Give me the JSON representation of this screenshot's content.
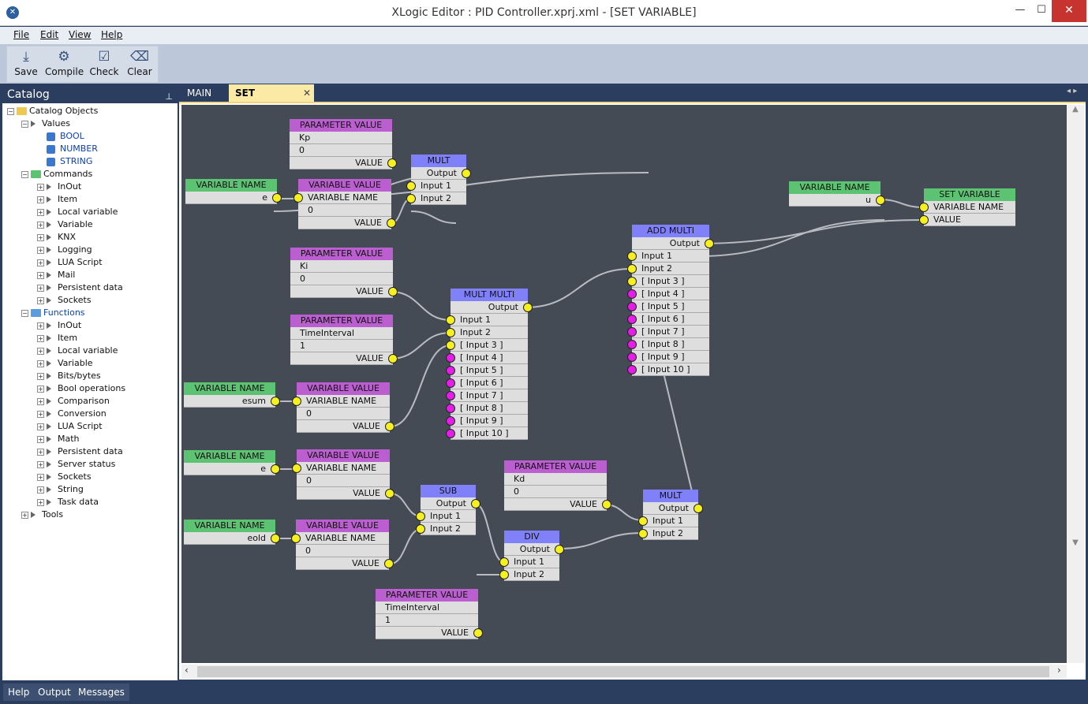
{
  "window": {
    "title": "XLogic Editor : PID Controller.xprj.xml - [SET VARIABLE]"
  },
  "menu": {
    "file": "File",
    "edit": "Edit",
    "view": "View",
    "help": "Help"
  },
  "toolbar": {
    "save": "Save",
    "compile": "Compile",
    "check": "Check",
    "clear": "Clear"
  },
  "catalog": {
    "title": "Catalog",
    "root": "Catalog Objects",
    "values": {
      "label": "Values",
      "items": [
        "BOOL",
        "NUMBER",
        "STRING"
      ]
    },
    "commands": {
      "label": "Commands",
      "items": [
        "InOut",
        "Item",
        "Local variable",
        "Variable",
        "KNX",
        "Logging",
        "LUA Script",
        "Mail",
        "Persistent data",
        "Sockets"
      ]
    },
    "functions": {
      "label": "Functions",
      "items": [
        "InOut",
        "Item",
        "Local variable",
        "Variable",
        "Bits/bytes",
        "Bool operations",
        "Comparison",
        "Conversion",
        "LUA Script",
        "Math",
        "Persistent data",
        "Server status",
        "Sockets",
        "String",
        "Task data"
      ]
    },
    "tools": "Tools"
  },
  "tabs": {
    "main": "MAIN",
    "active": "SET VARIABLE",
    "close": "✕"
  },
  "nodes": {
    "pv_kp": {
      "title": "PARAMETER VALUE",
      "name": "Kp",
      "value": "0",
      "out": "VALUE"
    },
    "vn_e1": {
      "title": "VARIABLE NAME",
      "name": "e"
    },
    "vv_e1": {
      "title": "VARIABLE VALUE",
      "label": "VARIABLE NAME",
      "value": "0",
      "out": "VALUE"
    },
    "mult1": {
      "title": "MULT",
      "out": "Output",
      "in1": "Input 1",
      "in2": "Input 2"
    },
    "pv_ki": {
      "title": "PARAMETER VALUE",
      "name": "Ki",
      "value": "0",
      "out": "VALUE"
    },
    "pv_ti1": {
      "title": "PARAMETER VALUE",
      "name": "TimeInterval",
      "value": "1",
      "out": "VALUE"
    },
    "vn_esum": {
      "title": "VARIABLE NAME",
      "name": "esum"
    },
    "vv_esum": {
      "title": "VARIABLE VALUE",
      "label": "VARIABLE NAME",
      "value": "0",
      "out": "VALUE"
    },
    "multmulti": {
      "title": "MULT MULTI",
      "out": "Output",
      "inputs": [
        "Input 1",
        "Input 2",
        "[ Input 3 ]",
        "[ Input 4 ]",
        "[ Input 5 ]",
        "[ Input 6 ]",
        "[ Input 7 ]",
        "[ Input 8 ]",
        "[ Input 9 ]",
        "[ Input 10 ]"
      ]
    },
    "addmulti": {
      "title": "ADD MULTI",
      "out": "Output",
      "inputs": [
        "Input 1",
        "Input 2",
        "[ Input 3 ]",
        "[ Input 4 ]",
        "[ Input 5 ]",
        "[ Input 6 ]",
        "[ Input 7 ]",
        "[ Input 8 ]",
        "[ Input 9 ]",
        "[ Input 10 ]"
      ]
    },
    "vn_u": {
      "title": "VARIABLE NAME",
      "name": "u"
    },
    "setvar": {
      "title": "SET VARIABLE",
      "in1": "VARIABLE NAME",
      "in2": "VALUE"
    },
    "vn_e2": {
      "title": "VARIABLE NAME",
      "name": "e"
    },
    "vv_e2": {
      "title": "VARIABLE VALUE",
      "label": "VARIABLE NAME",
      "value": "0",
      "out": "VALUE"
    },
    "vn_eold": {
      "title": "VARIABLE NAME",
      "name": "eold"
    },
    "vv_eold": {
      "title": "VARIABLE VALUE",
      "label": "VARIABLE NAME",
      "value": "0",
      "out": "VALUE"
    },
    "sub": {
      "title": "SUB",
      "out": "Output",
      "in1": "Input 1",
      "in2": "Input 2"
    },
    "pv_kd": {
      "title": "PARAMETER VALUE",
      "name": "Kd",
      "value": "0",
      "out": "VALUE"
    },
    "mult2": {
      "title": "MULT",
      "out": "Output",
      "in1": "Input 1",
      "in2": "Input 2"
    },
    "div": {
      "title": "DIV",
      "out": "Output",
      "in1": "Input 1",
      "in2": "Input 2"
    },
    "pv_ti2": {
      "title": "PARAMETER VALUE",
      "name": "TimeInterval",
      "value": "1",
      "out": "VALUE"
    }
  },
  "colors": {
    "param": "#bb5ecf",
    "varname": "#5cc372",
    "op": "#8080f8",
    "pin": "#f6f01e",
    "optional_pin": "#e61de6",
    "canvas": "#454b55"
  },
  "bottom_tabs": {
    "help": "Help",
    "output": "Output",
    "messages": "Messages"
  }
}
